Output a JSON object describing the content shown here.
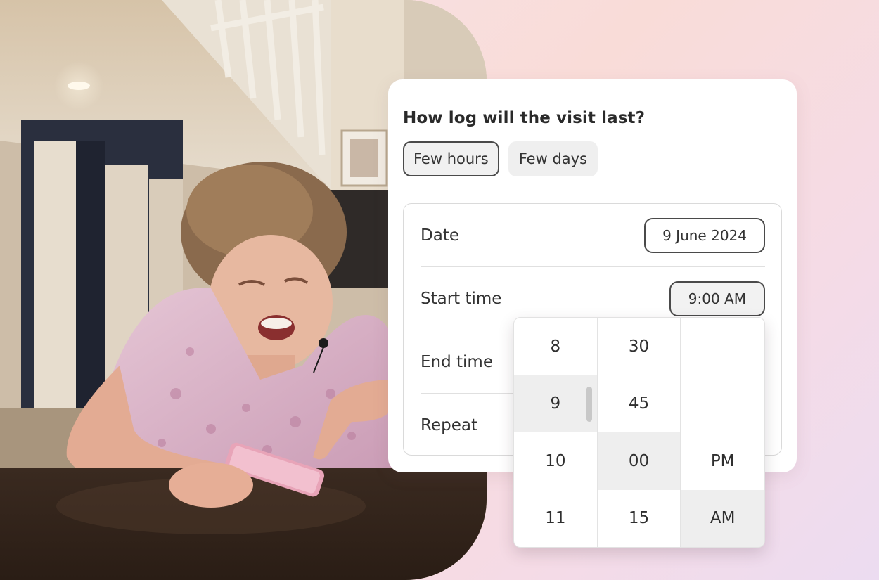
{
  "question": "How log will the visit last?",
  "duration_options": [
    {
      "label": "Few hours",
      "selected": true
    },
    {
      "label": "Few days",
      "selected": false
    }
  ],
  "form": {
    "date": {
      "label": "Date",
      "value": "9 June 2024"
    },
    "start_time": {
      "label": "Start time",
      "value": "9:00 AM"
    },
    "end_time": {
      "label": "End time"
    },
    "repeat": {
      "label": "Repeat"
    }
  },
  "time_picker": {
    "hours": [
      "8",
      "9",
      "10",
      "11"
    ],
    "minutes": [
      "30",
      "45",
      "00",
      "15"
    ],
    "periods": [
      "",
      "",
      "PM",
      "AM"
    ],
    "selected_hour": "9",
    "selected_minute": "00",
    "selected_period": "AM"
  },
  "colors": {
    "accent_border": "#4a4a4a",
    "highlight": "#eeeeee",
    "background_gradient_start": "#f7e3ea",
    "background_gradient_end": "#ecdcf1"
  }
}
